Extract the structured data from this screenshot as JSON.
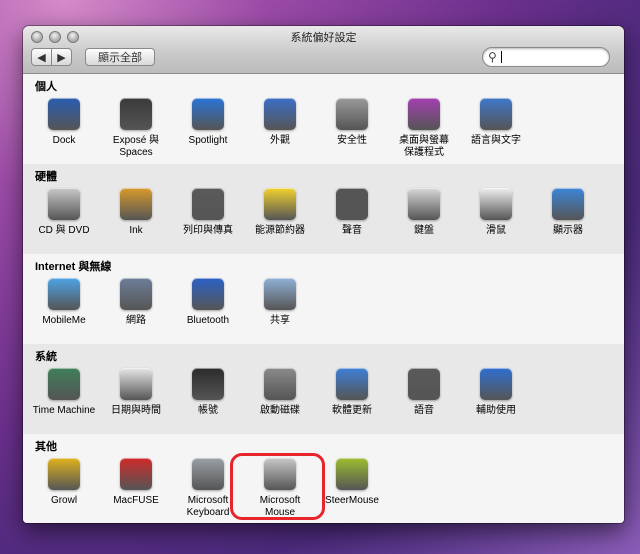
{
  "window": {
    "title": "系統偏好設定",
    "back_label": "◀",
    "forward_label": "▶",
    "show_all_label": "顯示全部",
    "search_value": "",
    "search_icon": "search-icon"
  },
  "sections": [
    {
      "title": "個人",
      "panes": [
        {
          "label": "Dock",
          "icon": "dock-icon",
          "color": "#2a5db0"
        },
        {
          "label": "Exposé 與\nSpaces",
          "icon": "expose-icon",
          "color": "#3a3a3a"
        },
        {
          "label": "Spotlight",
          "icon": "spotlight-icon",
          "color": "#2a74d6"
        },
        {
          "label": "外觀",
          "icon": "appearance-icon",
          "color": "#3b6fc7"
        },
        {
          "label": "安全性",
          "icon": "security-icon",
          "color": "#9a9a9a"
        },
        {
          "label": "桌面與螢幕\n保護程式",
          "icon": "desktop-icon",
          "color": "#a43fb0"
        },
        {
          "label": "語言與文字",
          "icon": "language-icon",
          "color": "#3e78c9"
        }
      ]
    },
    {
      "title": "硬體",
      "panes": [
        {
          "label": "CD 與 DVD",
          "icon": "cd-dvd-icon",
          "color": "#c9c9c9"
        },
        {
          "label": "Ink",
          "icon": "ink-icon",
          "color": "#d99a2b"
        },
        {
          "label": "列印與傳真",
          "icon": "printer-icon",
          "color": "#5a5a5a"
        },
        {
          "label": "能源節約器",
          "icon": "energy-saver-icon",
          "color": "#f2d22e"
        },
        {
          "label": "聲音",
          "icon": "sound-icon",
          "color": "#555555"
        },
        {
          "label": "鍵盤",
          "icon": "keyboard-icon",
          "color": "#d8d8d8"
        },
        {
          "label": "滑鼠",
          "icon": "mouse-icon",
          "color": "#f0f0f0"
        },
        {
          "label": "顯示器",
          "icon": "display-icon",
          "color": "#3c86d8"
        }
      ]
    },
    {
      "title": "Internet 與無線",
      "panes": [
        {
          "label": "MobileMe",
          "icon": "mobileme-icon",
          "color": "#4da3e6"
        },
        {
          "label": "網路",
          "icon": "network-icon",
          "color": "#6d7f99"
        },
        {
          "label": "Bluetooth",
          "icon": "bluetooth-icon",
          "color": "#2b62c6"
        },
        {
          "label": "共享",
          "icon": "sharing-icon",
          "color": "#8fb0d6"
        }
      ]
    },
    {
      "title": "系統",
      "panes": [
        {
          "label": "Time Machine",
          "icon": "time-machine-icon",
          "color": "#3f7f5a"
        },
        {
          "label": "日期與時間",
          "icon": "date-time-icon",
          "color": "#e8e8e8"
        },
        {
          "label": "帳號",
          "icon": "accounts-icon",
          "color": "#2b2b2b"
        },
        {
          "label": "啟動磁碟",
          "icon": "startup-disk-icon",
          "color": "#8a8a8a"
        },
        {
          "label": "軟體更新",
          "icon": "software-update-icon",
          "color": "#3d7fd6"
        },
        {
          "label": "語音",
          "icon": "speech-icon",
          "color": "#5a5a5a"
        },
        {
          "label": "輔助使用",
          "icon": "accessibility-icon",
          "color": "#2f6fd0"
        }
      ]
    },
    {
      "title": "其他",
      "panes": [
        {
          "label": "Growl",
          "icon": "growl-icon",
          "color": "#e0b31d"
        },
        {
          "label": "MacFUSE",
          "icon": "macfuse-icon",
          "color": "#cf2a2a"
        },
        {
          "label": "Microsoft\nKeyboard",
          "icon": "ms-keyboard-icon",
          "color": "#9aa0a6"
        },
        {
          "label": "Microsoft\nMouse",
          "icon": "ms-mouse-icon",
          "color": "#c8c8c8"
        },
        {
          "label": "SteerMouse",
          "icon": "steermouse-icon",
          "color": "#9dbd2e"
        }
      ]
    }
  ],
  "highlight_color": "#e8242d"
}
